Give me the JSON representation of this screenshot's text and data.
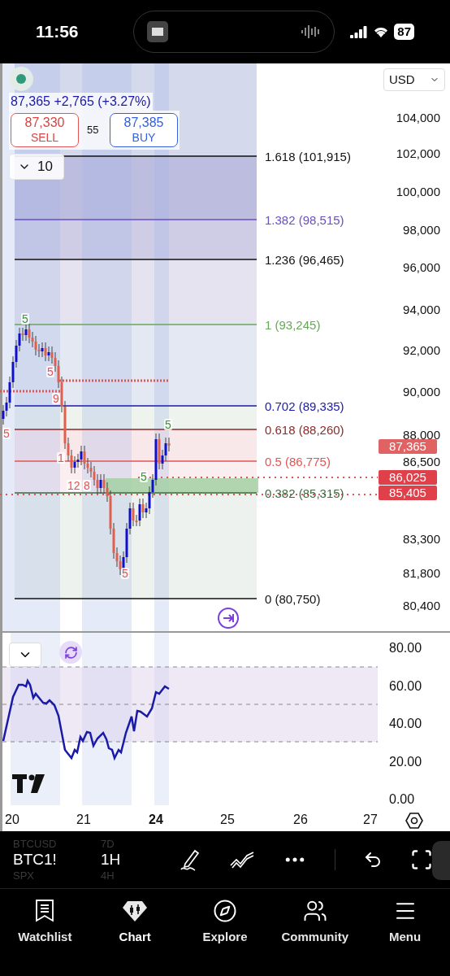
{
  "status_bar": {
    "time": "11:56",
    "battery": "87"
  },
  "chart": {
    "currency": "USD",
    "quote": {
      "price": "87,365",
      "change": "+2,765 (+3.27%)"
    },
    "sell": {
      "price": "87,330",
      "label": "SELL"
    },
    "spread": "55",
    "buy": {
      "price": "87,385",
      "label": "BUY"
    },
    "collapse_count": "10",
    "fib_levels": [
      {
        "label": "1.618 (101,915)",
        "color": "#111111"
      },
      {
        "label": "1.382 (98,515)",
        "color": "#6a4fc2"
      },
      {
        "label": "1.236 (96,465)",
        "color": "#111111"
      },
      {
        "label": "1 (93,245)",
        "color": "#6aa65e"
      },
      {
        "label": "0.702 (89,335)",
        "color": "#1a1aa8"
      },
      {
        "label": "0.618 (88,260)",
        "color": "#8b2a2a"
      },
      {
        "label": "0.5 (86,775)",
        "color": "#e05555"
      },
      {
        "label": "0.382 (85,315)",
        "color": "#3d6b3d"
      },
      {
        "label": "0 (80,750)",
        "color": "#111111"
      }
    ],
    "price_axis": [
      "104,000",
      "102,000",
      "100,000",
      "98,000",
      "96,000",
      "94,000",
      "92,000",
      "90,000",
      "88,000",
      "86,500",
      "83,300",
      "81,800",
      "80,400"
    ],
    "price_tags": [
      {
        "value": "87,365",
        "color": "#e06262"
      },
      {
        "value": "86,025",
        "color": "#e0404a"
      },
      {
        "value": "85,405",
        "color": "#e0404a"
      }
    ],
    "markers": [
      {
        "text": "5",
        "color": "#3f8f3f"
      },
      {
        "text": "5",
        "color": "#e05555"
      },
      {
        "text": "9",
        "color": "#e05555"
      },
      {
        "text": "5",
        "color": "#e05555"
      },
      {
        "text": "1",
        "color": "#e05555"
      },
      {
        "text": "12",
        "color": "#e05555"
      },
      {
        "text": "8",
        "color": "#e05555"
      },
      {
        "text": "5",
        "color": "#3f8f3f"
      },
      {
        "text": "5",
        "color": "#3f8f3f"
      },
      {
        "text": "5",
        "color": "#e05555"
      }
    ]
  },
  "oscillator": {
    "axis": [
      "80.00",
      "60.00",
      "40.00",
      "20.00",
      "0.00"
    ]
  },
  "time_axis": [
    {
      "label": "20",
      "bold": false
    },
    {
      "label": "21",
      "bold": false
    },
    {
      "label": "24",
      "bold": true
    },
    {
      "label": "25",
      "bold": false
    },
    {
      "label": "26",
      "bold": false
    },
    {
      "label": "27",
      "bold": false
    }
  ],
  "toolbar": {
    "symbols": [
      {
        "label": "BTCUSD",
        "selected": false
      },
      {
        "label": "BTC1!",
        "selected": true
      },
      {
        "label": "SPX",
        "selected": false
      }
    ],
    "intervals": [
      {
        "label": "7D",
        "selected": false
      },
      {
        "label": "1H",
        "selected": true
      },
      {
        "label": "4H",
        "selected": false
      }
    ]
  },
  "tabs": [
    {
      "label": "Watchlist",
      "selected": false
    },
    {
      "label": "Chart",
      "selected": true
    },
    {
      "label": "Explore",
      "selected": false
    },
    {
      "label": "Community",
      "selected": false
    },
    {
      "label": "Menu",
      "selected": false
    }
  ]
}
